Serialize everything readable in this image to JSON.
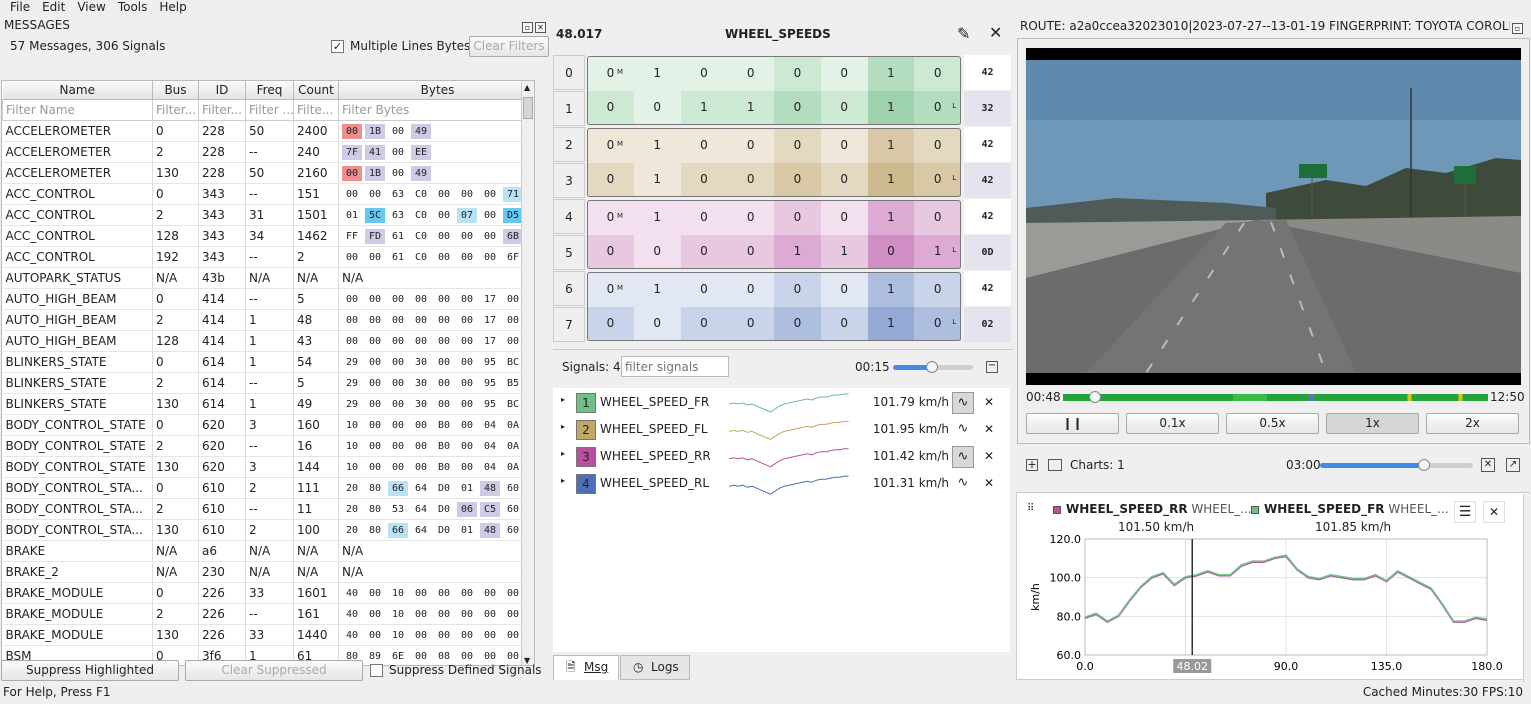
{
  "menu": [
    "File",
    "Edit",
    "View",
    "Tools",
    "Help"
  ],
  "messages_panel": {
    "title": "MESSAGES",
    "summary": "57 Messages, 306 Signals",
    "multiline_label": "Multiple Lines Bytes",
    "clear_filters": "Clear Filters",
    "columns": [
      "Name",
      "Bus",
      "ID",
      "Freq",
      "Count",
      "Bytes"
    ],
    "filters": [
      "Filter Name",
      "Filter...",
      "Filter...",
      "Filter ...",
      "Filte...",
      "Filter Bytes"
    ],
    "rows": [
      {
        "name": "ACCELEROMETER",
        "bus": "0",
        "id": "228",
        "freq": "50",
        "count": "2400",
        "bytes": [
          "00",
          "1B",
          "00",
          "49"
        ],
        "hl": [
          "r",
          "p",
          "",
          "p"
        ]
      },
      {
        "name": "ACCELEROMETER",
        "bus": "2",
        "id": "228",
        "freq": "--",
        "count": "240",
        "bytes": [
          "7F",
          "41",
          "00",
          "EE"
        ],
        "hl": [
          "p",
          "p",
          "",
          "p"
        ]
      },
      {
        "name": "ACCELEROMETER",
        "bus": "130",
        "id": "228",
        "freq": "50",
        "count": "2160",
        "bytes": [
          "00",
          "1B",
          "00",
          "49"
        ],
        "hl": [
          "r",
          "p",
          "",
          "p"
        ]
      },
      {
        "name": "ACC_CONTROL",
        "bus": "0",
        "id": "343",
        "freq": "--",
        "count": "151",
        "bytes": [
          "00",
          "00",
          "63",
          "C0",
          "00",
          "00",
          "00",
          "71"
        ],
        "hl": [
          "",
          "",
          "",
          "",
          "",
          "",
          "",
          "b"
        ]
      },
      {
        "name": "ACC_CONTROL",
        "bus": "2",
        "id": "343",
        "freq": "31",
        "count": "1501",
        "bytes": [
          "01",
          "5C",
          "63",
          "C0",
          "00",
          "07",
          "00",
          "D5"
        ],
        "hl": [
          "",
          "B",
          "",
          "",
          "",
          "b",
          "",
          "B"
        ]
      },
      {
        "name": "ACC_CONTROL",
        "bus": "128",
        "id": "343",
        "freq": "34",
        "count": "1462",
        "bytes": [
          "FF",
          "FD",
          "61",
          "C0",
          "00",
          "00",
          "00",
          "6B"
        ],
        "hl": [
          "",
          "p",
          "",
          "",
          "",
          "",
          "",
          "p"
        ]
      },
      {
        "name": "ACC_CONTROL",
        "bus": "192",
        "id": "343",
        "freq": "--",
        "count": "2",
        "bytes": [
          "00",
          "00",
          "61",
          "C0",
          "00",
          "00",
          "00",
          "6F"
        ],
        "hl": [
          "",
          "",
          "",
          "",
          "",
          "",
          "",
          ""
        ]
      },
      {
        "name": "AUTOPARK_STATUS",
        "bus": "N/A",
        "id": "43b",
        "freq": "N/A",
        "count": "N/A",
        "bytes_text": "N/A"
      },
      {
        "name": "AUTO_HIGH_BEAM",
        "bus": "0",
        "id": "414",
        "freq": "--",
        "count": "5",
        "bytes": [
          "00",
          "00",
          "00",
          "00",
          "00",
          "00",
          "17",
          "00"
        ],
        "hl": []
      },
      {
        "name": "AUTO_HIGH_BEAM",
        "bus": "2",
        "id": "414",
        "freq": "1",
        "count": "48",
        "bytes": [
          "00",
          "00",
          "00",
          "00",
          "00",
          "00",
          "17",
          "00"
        ],
        "hl": []
      },
      {
        "name": "AUTO_HIGH_BEAM",
        "bus": "128",
        "id": "414",
        "freq": "1",
        "count": "43",
        "bytes": [
          "00",
          "00",
          "00",
          "00",
          "00",
          "00",
          "17",
          "00"
        ],
        "hl": []
      },
      {
        "name": "BLINKERS_STATE",
        "bus": "0",
        "id": "614",
        "freq": "1",
        "count": "54",
        "bytes": [
          "29",
          "00",
          "00",
          "30",
          "00",
          "00",
          "95",
          "BC"
        ],
        "hl": []
      },
      {
        "name": "BLINKERS_STATE",
        "bus": "2",
        "id": "614",
        "freq": "--",
        "count": "5",
        "bytes": [
          "29",
          "00",
          "00",
          "30",
          "00",
          "00",
          "95",
          "B5"
        ],
        "hl": []
      },
      {
        "name": "BLINKERS_STATE",
        "bus": "130",
        "id": "614",
        "freq": "1",
        "count": "49",
        "bytes": [
          "29",
          "00",
          "00",
          "30",
          "00",
          "00",
          "95",
          "BC"
        ],
        "hl": []
      },
      {
        "name": "BODY_CONTROL_STATE",
        "bus": "0",
        "id": "620",
        "freq": "3",
        "count": "160",
        "bytes": [
          "10",
          "00",
          "00",
          "00",
          "B0",
          "00",
          "04",
          "0A"
        ],
        "hl": []
      },
      {
        "name": "BODY_CONTROL_STATE",
        "bus": "2",
        "id": "620",
        "freq": "--",
        "count": "16",
        "bytes": [
          "10",
          "00",
          "00",
          "00",
          "B0",
          "00",
          "04",
          "0A"
        ],
        "hl": []
      },
      {
        "name": "BODY_CONTROL_STATE",
        "bus": "130",
        "id": "620",
        "freq": "3",
        "count": "144",
        "bytes": [
          "10",
          "00",
          "00",
          "00",
          "B0",
          "00",
          "04",
          "0A"
        ],
        "hl": []
      },
      {
        "name": "BODY_CONTROL_STA...",
        "bus": "0",
        "id": "610",
        "freq": "2",
        "count": "111",
        "bytes": [
          "20",
          "80",
          "66",
          "64",
          "D0",
          "01",
          "48",
          "60"
        ],
        "hl": [
          "",
          "",
          "b",
          "",
          "",
          "",
          "p",
          ""
        ]
      },
      {
        "name": "BODY_CONTROL_STA...",
        "bus": "2",
        "id": "610",
        "freq": "--",
        "count": "11",
        "bytes": [
          "20",
          "80",
          "53",
          "64",
          "D0",
          "06",
          "C5",
          "60"
        ],
        "hl": [
          "",
          "",
          "",
          "",
          "",
          "p",
          "p",
          ""
        ]
      },
      {
        "name": "BODY_CONTROL_STA...",
        "bus": "130",
        "id": "610",
        "freq": "2",
        "count": "100",
        "bytes": [
          "20",
          "80",
          "66",
          "64",
          "D0",
          "01",
          "48",
          "60"
        ],
        "hl": [
          "",
          "",
          "b",
          "",
          "",
          "",
          "p",
          ""
        ]
      },
      {
        "name": "BRAKE",
        "bus": "N/A",
        "id": "a6",
        "freq": "N/A",
        "count": "N/A",
        "bytes_text": "N/A"
      },
      {
        "name": "BRAKE_2",
        "bus": "N/A",
        "id": "230",
        "freq": "N/A",
        "count": "N/A",
        "bytes_text": "N/A"
      },
      {
        "name": "BRAKE_MODULE",
        "bus": "0",
        "id": "226",
        "freq": "33",
        "count": "1601",
        "bytes": [
          "40",
          "00",
          "10",
          "00",
          "00",
          "00",
          "00",
          "00"
        ],
        "hl": []
      },
      {
        "name": "BRAKE_MODULE",
        "bus": "2",
        "id": "226",
        "freq": "--",
        "count": "161",
        "bytes": [
          "40",
          "00",
          "10",
          "00",
          "00",
          "00",
          "00",
          "00"
        ],
        "hl": []
      },
      {
        "name": "BRAKE_MODULE",
        "bus": "130",
        "id": "226",
        "freq": "33",
        "count": "1440",
        "bytes": [
          "40",
          "00",
          "10",
          "00",
          "00",
          "00",
          "00",
          "00"
        ],
        "hl": []
      },
      {
        "name": "BSM",
        "bus": "0",
        "id": "3f6",
        "freq": "1",
        "count": "61",
        "bytes": [
          "80",
          "89",
          "6E",
          "00",
          "08",
          "00",
          "00",
          "00"
        ],
        "hl": []
      }
    ],
    "suppress_highlighted": "Suppress Highlighted",
    "clear_suppressed": "Clear Suppressed",
    "suppress_defined": "Suppress Defined Signals"
  },
  "binary_view": {
    "time": "48.017",
    "message_name": "WHEEL_SPEEDS",
    "rows": [
      {
        "idx": "0",
        "bits": [
          "0",
          "1",
          "0",
          "0",
          "0",
          "0",
          "1",
          "0"
        ],
        "hex": "42",
        "msb": true,
        "lsb": false
      },
      {
        "idx": "1",
        "bits": [
          "0",
          "0",
          "1",
          "1",
          "0",
          "0",
          "1",
          "0"
        ],
        "hex": "32",
        "msb": false,
        "lsb": true
      },
      {
        "idx": "2",
        "bits": [
          "0",
          "1",
          "0",
          "0",
          "0",
          "0",
          "1",
          "0"
        ],
        "hex": "42",
        "msb": true,
        "lsb": false
      },
      {
        "idx": "3",
        "bits": [
          "0",
          "1",
          "0",
          "0",
          "0",
          "0",
          "1",
          "0"
        ],
        "hex": "42",
        "msb": false,
        "lsb": true
      },
      {
        "idx": "4",
        "bits": [
          "0",
          "1",
          "0",
          "0",
          "0",
          "0",
          "1",
          "0"
        ],
        "hex": "42",
        "msb": true,
        "lsb": false
      },
      {
        "idx": "5",
        "bits": [
          "0",
          "0",
          "0",
          "0",
          "1",
          "1",
          "0",
          "1"
        ],
        "hex": "0D",
        "msb": false,
        "lsb": true
      },
      {
        "idx": "6",
        "bits": [
          "0",
          "1",
          "0",
          "0",
          "0",
          "0",
          "1",
          "0"
        ],
        "hex": "42",
        "msb": true,
        "lsb": false
      },
      {
        "idx": "7",
        "bits": [
          "0",
          "0",
          "0",
          "0",
          "0",
          "0",
          "1",
          "0"
        ],
        "hex": "02",
        "msb": false,
        "lsb": true
      }
    ],
    "signals_label": "Signals: 4",
    "filter_placeholder": "filter signals",
    "zoom_time": "00:15",
    "signals": [
      {
        "idx": "1",
        "name": "WHEEL_SPEED_FR",
        "value": "101.79 km/h",
        "color": "#6ec086",
        "plotted": true
      },
      {
        "idx": "2",
        "name": "WHEEL_SPEED_FL",
        "value": "101.95 km/h",
        "color": "#c2a866",
        "plotted": false
      },
      {
        "idx": "3",
        "name": "WHEEL_SPEED_RR",
        "value": "101.42 km/h",
        "color": "#bb4f9f",
        "plotted": true
      },
      {
        "idx": "4",
        "name": "WHEEL_SPEED_RL",
        "value": "101.31 km/h",
        "color": "#4d6fb7",
        "plotted": false
      }
    ],
    "tabs": [
      "Msg",
      "Logs"
    ],
    "msb_mark": "M",
    "lsb_mark": "L"
  },
  "video": {
    "route_label": "ROUTE: a2a0ccea32023010|2023-07-27--13-01-19  FINGERPRINT: TOYOTA COROLL...",
    "time_current": "00:48",
    "time_total": "12:50",
    "speed_buttons": [
      "0.1x",
      "0.5x",
      "1x",
      "2x"
    ],
    "active_speed": "1x",
    "pause_icon": "pause-icon",
    "progress": 0.062
  },
  "charts": {
    "label": "Charts: 1",
    "range": "03:00",
    "legend": [
      {
        "name": "WHEEL_SPEED_RR",
        "msg": "WHEEL_...",
        "value": "101.50 km/h",
        "color": "#bb4f9f"
      },
      {
        "name": "WHEEL_SPEED_FR",
        "msg": "WHEEL_...",
        "value": "101.85 km/h",
        "color": "#6ec086"
      }
    ],
    "cursor_label": "48.02",
    "unit_label": "km/h"
  },
  "chart_data": {
    "type": "line",
    "ylabel": "km/h",
    "xlim": [
      0,
      180
    ],
    "ylim": [
      60,
      120
    ],
    "xticks": [
      "0.0",
      "45.0",
      "90.0",
      "135.0",
      "180.0"
    ],
    "yticks": [
      "60.0",
      "80.0",
      "100.0",
      "120.0"
    ],
    "cursor_x": 48.02,
    "series": [
      {
        "name": "WHEEL_SPEED_RR",
        "color": "#bb4f9f",
        "x": [
          0,
          5,
          10,
          15,
          20,
          25,
          30,
          35,
          40,
          45,
          50,
          55,
          60,
          65,
          70,
          75,
          80,
          85,
          90,
          95,
          100,
          105,
          110,
          115,
          120,
          125,
          130,
          135,
          140,
          145,
          150,
          155,
          160,
          165,
          170,
          175,
          180
        ],
        "y": [
          79,
          81,
          77,
          80,
          88,
          95,
          100,
          102,
          96,
          100,
          101,
          103,
          101,
          101,
          106,
          108,
          108,
          110,
          111,
          104,
          100,
          99,
          101,
          100,
          99,
          99,
          101,
          98,
          103,
          100,
          97,
          94,
          86,
          77,
          77,
          79,
          78
        ]
      },
      {
        "name": "WHEEL_SPEED_FR",
        "color": "#6ec086",
        "x": [
          0,
          5,
          10,
          15,
          20,
          25,
          30,
          35,
          40,
          45,
          50,
          55,
          60,
          65,
          70,
          75,
          80,
          85,
          90,
          95,
          100,
          105,
          110,
          115,
          120,
          125,
          130,
          135,
          140,
          145,
          150,
          155,
          160,
          165,
          170,
          175,
          180
        ],
        "y": [
          79.5,
          81.5,
          77.5,
          80.5,
          88.5,
          95.5,
          100.5,
          102.5,
          96.5,
          100.5,
          101.5,
          103.5,
          101.5,
          101.5,
          106.5,
          108.5,
          108.5,
          110.5,
          111.5,
          104.5,
          100.5,
          99.5,
          101.5,
          100.5,
          99.5,
          99.5,
          101.5,
          98.5,
          103.5,
          100.5,
          97.5,
          94.5,
          86.5,
          77.5,
          77.5,
          79.5,
          78.5
        ]
      }
    ]
  },
  "status": {
    "help": "For Help, Press F1",
    "right": "Cached Minutes:30 FPS:10"
  }
}
